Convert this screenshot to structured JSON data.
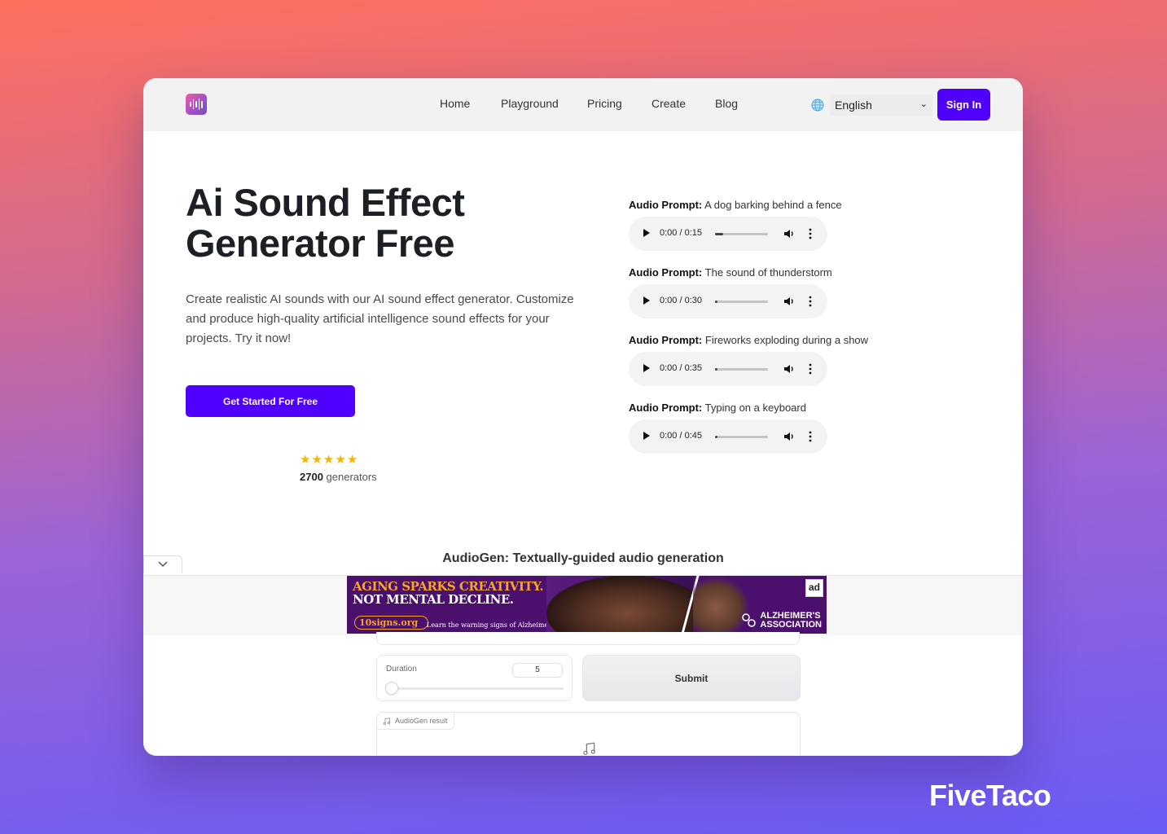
{
  "header": {
    "nav": [
      {
        "label": "Home"
      },
      {
        "label": "Playground"
      },
      {
        "label": "Pricing"
      },
      {
        "label": "Create"
      },
      {
        "label": "Blog"
      }
    ],
    "language": "English",
    "signin_label": "Sign In"
  },
  "hero": {
    "title": "Ai Sound Effect Generator Free",
    "description": "Create realistic AI sounds with our AI sound effect generator. Customize and produce high-quality artificial intelligence sound effects for your projects. Try it now!",
    "cta_label": "Get Started For Free",
    "stars": 5,
    "rating_count": "2700",
    "rating_suffix": " generators"
  },
  "audio_samples": [
    {
      "label": "Audio Prompt:",
      "prompt": "A dog barking behind a fence",
      "time": "0:00 / 0:15",
      "progress": 0.15
    },
    {
      "label": "Audio Prompt:",
      "prompt": "The sound of thunderstorm",
      "time": "0:00 / 0:30",
      "progress": 0.0
    },
    {
      "label": "Audio Prompt:",
      "prompt": "Fireworks exploding during a show",
      "time": "0:00 / 0:35",
      "progress": 0.0
    },
    {
      "label": "Audio Prompt:",
      "prompt": "Typing on a keyboard",
      "time": "0:00 / 0:45",
      "progress": 0.0
    }
  ],
  "audiogen": {
    "title": "AudioGen: Textually-guided audio generation",
    "duration_label": "Duration",
    "duration_value": "5",
    "submit_label": "Submit",
    "result_label": "AudioGen result"
  },
  "ad": {
    "line1": "AGING SPARKS CREATIVITY.",
    "line2": "NOT MENTAL DECLINE.",
    "site": "10signs.org",
    "warning": "Learn the warning signs of Alzheimer's.",
    "org_line1": "ALZHEIMER'S",
    "org_line2": "ASSOCIATION",
    "badge": "ad"
  },
  "colors": {
    "accent": "#4f00ff",
    "star": "#f2b705"
  },
  "watermark": "FiveTaco"
}
